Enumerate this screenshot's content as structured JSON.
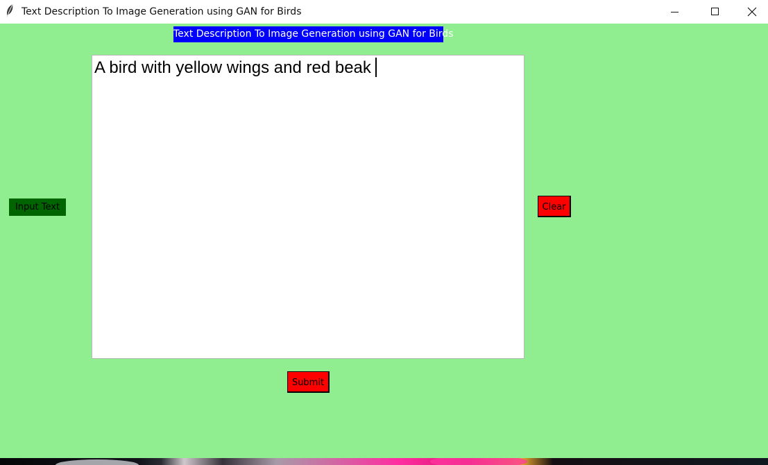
{
  "window": {
    "title": "Text Description To Image Generation using GAN for Birds",
    "icon": "feather-icon",
    "controls": [
      "minimize-icon",
      "maximize-icon",
      "close-icon"
    ]
  },
  "main": {
    "heading": "Text Description To Image Generation using GAN for Birds",
    "input_label": "Input Text",
    "text_input_value": "A bird with yellow wings and red beak",
    "clear_label": "Clear",
    "submit_label": "Submit"
  },
  "colors": {
    "client_background": "#90ee90",
    "heading_background": "#0000ff",
    "heading_text": "#ffffff",
    "input_label_background": "#006400",
    "button_background": "#ff0000",
    "text_area_background": "#ffffff"
  }
}
